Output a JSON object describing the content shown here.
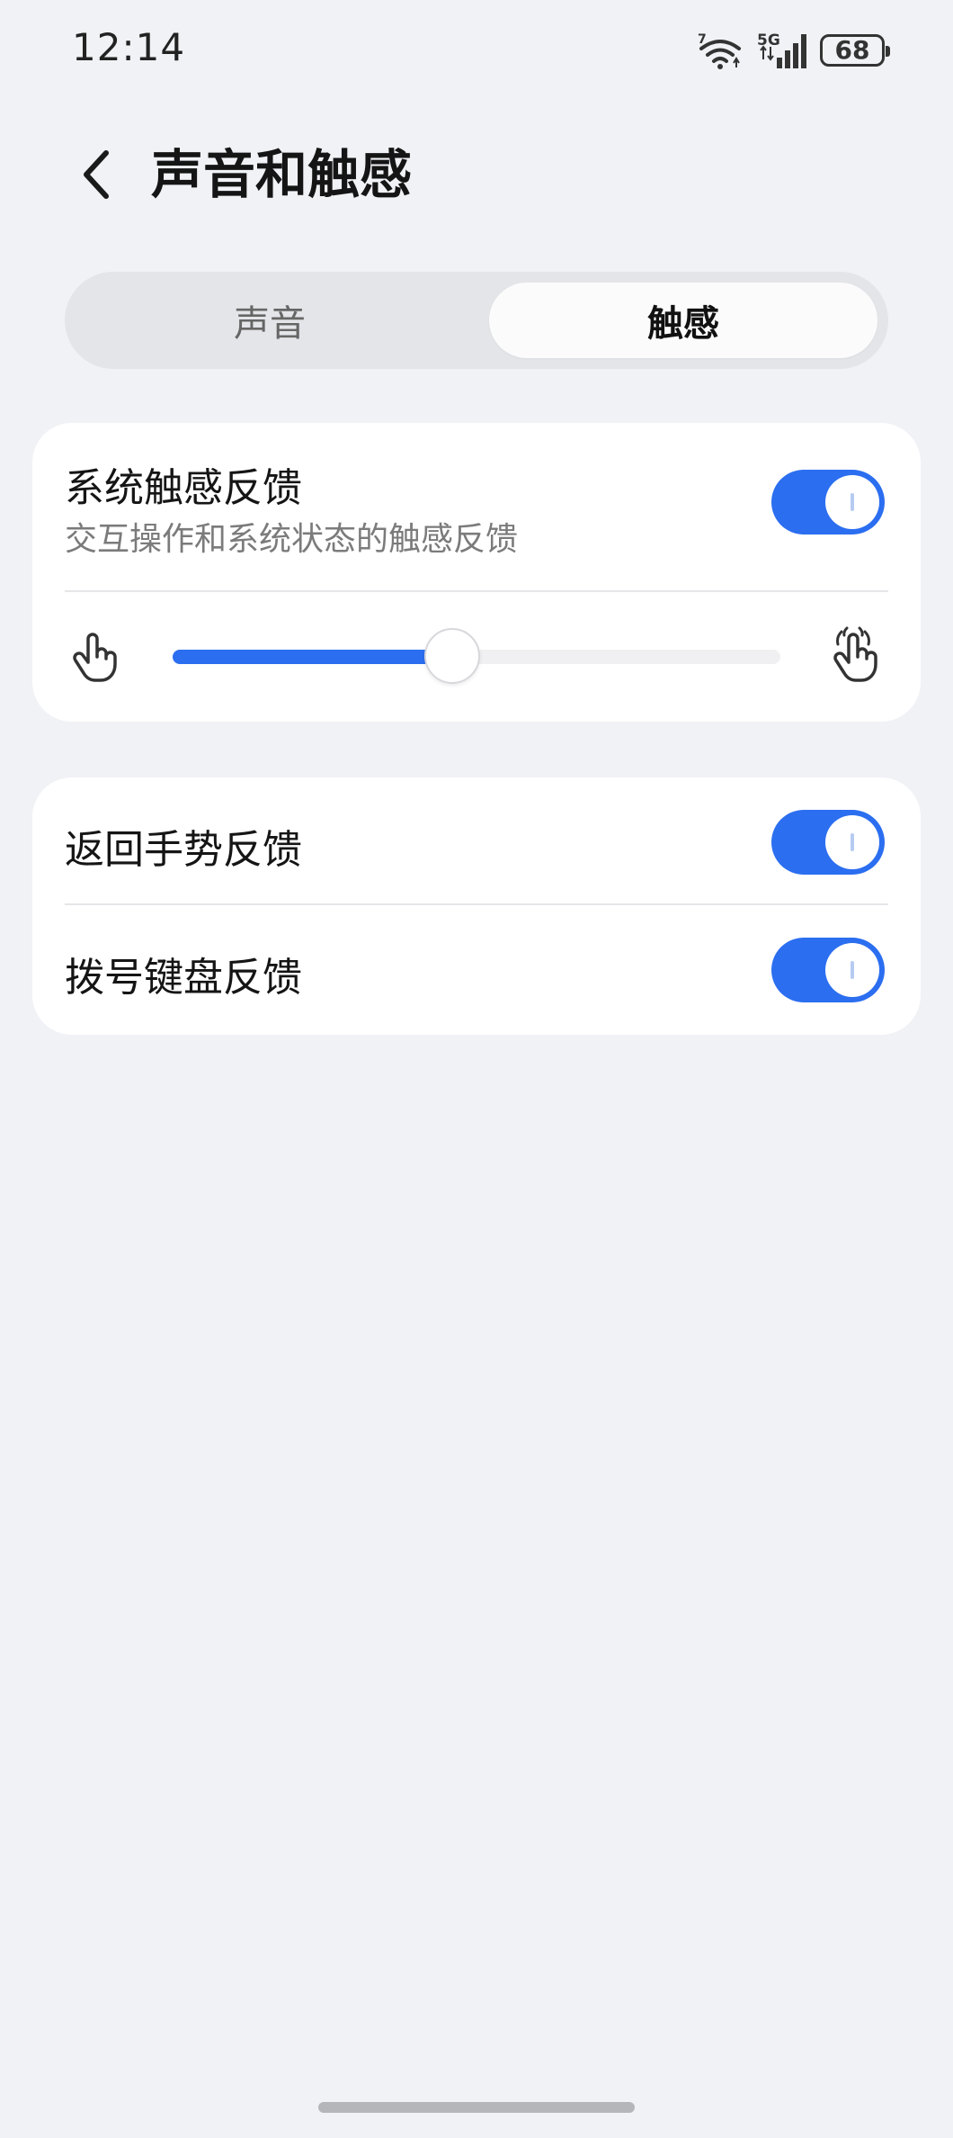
{
  "status_bar": {
    "time": "12:14",
    "wifi_badge": "7",
    "network": "5G",
    "battery": "68",
    "icons": [
      "wifi-icon",
      "signal-icon",
      "battery-icon"
    ]
  },
  "header": {
    "title": "声音和触感",
    "back_icon": "chevron-left-icon"
  },
  "tabs": [
    {
      "label": "声音",
      "selected": false
    },
    {
      "label": "触感",
      "selected": true
    }
  ],
  "haptics_card": {
    "title": "系统触感反馈",
    "subtitle": "交互操作和系统状态的触感反馈",
    "toggle_on": true,
    "intensity": 0.46,
    "min_icon": "hand-tap-light-icon",
    "max_icon": "hand-tap-strong-icon"
  },
  "other_card": {
    "items": [
      {
        "label": "返回手势反馈",
        "toggle_on": true
      },
      {
        "label": "拨号键盘反馈",
        "toggle_on": true
      }
    ]
  },
  "colors": {
    "accent": "#2b6ef0",
    "background": "#f1f2f6",
    "card": "#ffffff"
  }
}
